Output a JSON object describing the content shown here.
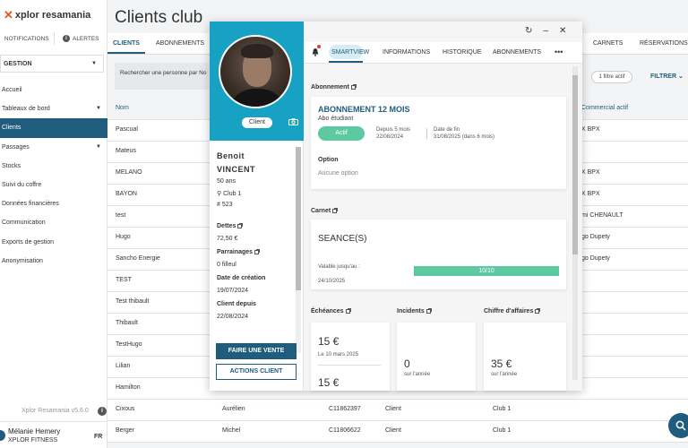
{
  "app": {
    "logo_brand": "xplor resamania",
    "notifications": "NOTIFICATIONS",
    "alerts": "ALERTES",
    "section": "GESTION",
    "version": "Xplor Resamania v5.6.0",
    "user_name": "Mélanie Hemery",
    "user_org": "XPLOR FITNESS",
    "lang": "FR"
  },
  "sidebar": {
    "items": [
      {
        "label": "Accueil",
        "active": false,
        "chevron": false
      },
      {
        "label": "Tableaux de bord",
        "active": false,
        "chevron": true
      },
      {
        "label": "Clients",
        "active": true,
        "chevron": false
      },
      {
        "label": "Passages",
        "active": false,
        "chevron": true
      },
      {
        "label": "Stocks",
        "active": false,
        "chevron": false
      },
      {
        "label": "Suivi du coffre",
        "active": false,
        "chevron": false
      },
      {
        "label": "Données financières",
        "active": false,
        "chevron": false
      },
      {
        "label": "Communication",
        "active": false,
        "chevron": false
      },
      {
        "label": "Exports de gestion",
        "active": false,
        "chevron": false
      },
      {
        "label": "Anonymisation",
        "active": false,
        "chevron": false
      }
    ]
  },
  "main": {
    "title": "Clients club",
    "tabs": {
      "clients": "CLIENTS",
      "abonnements": "ABONNEMENTS",
      "carnets": "CARNETS",
      "reservations": "RÉSERVATIONS"
    },
    "search_placeholder": "Rechercher une personne par No",
    "filter_chip": "1 filtre actif",
    "filter_btn": "FILTRER",
    "columns": {
      "nom": "Nom",
      "commercial": "Commercial actif"
    },
    "rows": [
      {
        "nom": "Pascual",
        "prenom": "",
        "id": "",
        "type": "",
        "club": "",
        "commercial": "X BPX"
      },
      {
        "nom": "Mateus",
        "prenom": "",
        "id": "",
        "type": "",
        "club": "",
        "commercial": ""
      },
      {
        "nom": "MELANO",
        "prenom": "",
        "id": "",
        "type": "",
        "club": "",
        "commercial": "X BPX"
      },
      {
        "nom": "BAYON",
        "prenom": "",
        "id": "",
        "type": "",
        "club": "",
        "commercial": "X BPX"
      },
      {
        "nom": "test",
        "prenom": "",
        "id": "",
        "type": "",
        "club": "",
        "commercial": "mi CHENAULT"
      },
      {
        "nom": "Hugo",
        "prenom": "",
        "id": "",
        "type": "",
        "club": "",
        "commercial": "go Dupety"
      },
      {
        "nom": "Sancho Energie",
        "prenom": "",
        "id": "",
        "type": "",
        "club": "",
        "commercial": "go Dupety"
      },
      {
        "nom": "TEST",
        "prenom": "",
        "id": "",
        "type": "",
        "club": "",
        "commercial": ""
      },
      {
        "nom": "Test thibault",
        "prenom": "",
        "id": "",
        "type": "",
        "club": "",
        "commercial": ""
      },
      {
        "nom": "Thibault",
        "prenom": "",
        "id": "",
        "type": "",
        "club": "",
        "commercial": ""
      },
      {
        "nom": "TestHugo",
        "prenom": "",
        "id": "",
        "type": "",
        "club": "",
        "commercial": ""
      },
      {
        "nom": "Lilian",
        "prenom": "",
        "id": "",
        "type": "",
        "club": "",
        "commercial": ""
      },
      {
        "nom": "Hamilton",
        "prenom": "",
        "id": "",
        "type": "",
        "club": "",
        "commercial": ""
      },
      {
        "nom": "Cixous",
        "prenom": "Aurélien",
        "id": "C11862397",
        "type": "Client",
        "club": "Club 1",
        "commercial": ""
      },
      {
        "nom": "Berger",
        "prenom": "Michel",
        "id": "C11806622",
        "type": "Client",
        "club": "Club 1",
        "commercial": ""
      }
    ]
  },
  "modal": {
    "client_pill": "Client",
    "first_name": "Benoit",
    "last_name": "VINCENT",
    "age": "50 ans",
    "club": "Club 1",
    "number": "# 523",
    "dettes_label": "Dettes",
    "dettes_value": "72,50 €",
    "parrainages_label": "Parrainages",
    "parrainages_value": "0 filleul",
    "creation_label": "Date de création",
    "creation_value": "19/07/2024",
    "client_depuis_label": "Client depuis",
    "client_depuis_value": "22/08/2024",
    "btn_vente": "FAIRE UNE VENTE",
    "btn_actions": "ACTIONS CLIENT",
    "tabs": {
      "smartview": "SMARTVIEW",
      "informations": "INFORMATIONS",
      "historique": "HISTORIQUE",
      "abonnements": "ABONNEMENTS"
    },
    "abonnement": {
      "section": "Abonnement",
      "title": "ABONNEMENT 12 MOIS",
      "subtitle": "Abo étudiant",
      "status": "Actif",
      "depuis_label": "Depuis 5 mois",
      "depuis_date": "22/08/2024",
      "fin_label": "Date de fin",
      "fin_date": "31/08/2025",
      "fin_note": "(dans 6 mois)",
      "option_label": "Option",
      "option_value": "Aucune option"
    },
    "carnet": {
      "section": "Carnet",
      "title": "SEANCE(S)",
      "valid_label": "Valable jusqu'au :",
      "valid_date": "24/10/2025",
      "progress_text": "10/10",
      "progress_fraction": 1
    },
    "echeances": {
      "section": "Échéances",
      "amount1": "15 €",
      "date1": "Le 10 mars 2025",
      "amount2": "15 €"
    },
    "incidents": {
      "section": "Incidents",
      "value": "0",
      "sub": "sur l'année"
    },
    "ca": {
      "section": "Chiffre d'affaires",
      "value": "35 €",
      "sub": "sur l'année"
    }
  },
  "colors": {
    "primary": "#1f5c7e",
    "teal": "#17a2c4",
    "green": "#5cc9a0",
    "brand_orange": "#e8541e"
  }
}
